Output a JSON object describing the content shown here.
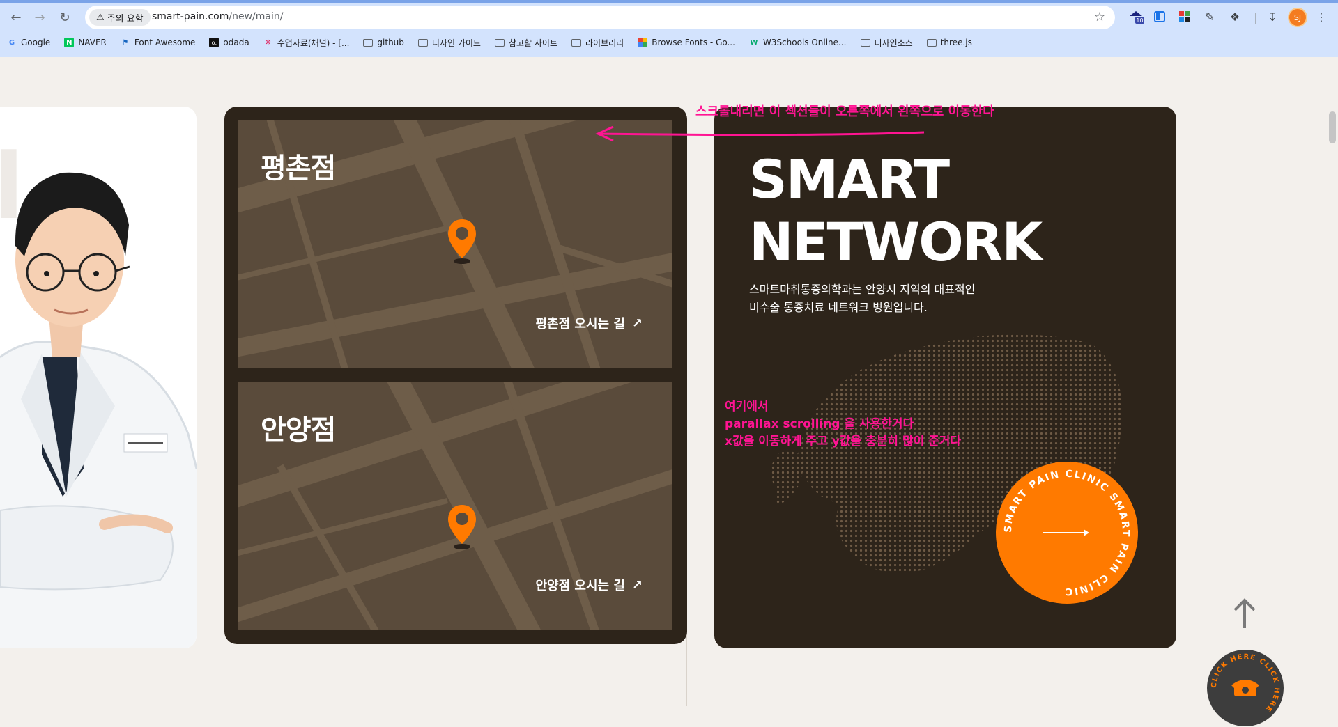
{
  "browser": {
    "security_chip": "주의 요함",
    "url_host": "smart-pain.com",
    "url_path": "/new/main/",
    "profile_initials": "SJ",
    "extension_badge": "10",
    "bookmarks": [
      {
        "label": "Google",
        "icon": "google-icon"
      },
      {
        "label": "NAVER",
        "icon": "naver-icon"
      },
      {
        "label": "Font Awesome",
        "icon": "flag-icon"
      },
      {
        "label": "odada",
        "icon": "odada-icon"
      },
      {
        "label": "수업자료(채널) - [...",
        "icon": "slack-icon"
      },
      {
        "label": "github",
        "icon": "folder-icon"
      },
      {
        "label": "디자인 가이드",
        "icon": "folder-icon"
      },
      {
        "label": "참고할 사이트",
        "icon": "folder-icon"
      },
      {
        "label": "라이브러리",
        "icon": "folder-icon"
      },
      {
        "label": "Browse Fonts - Go...",
        "icon": "google-fonts-icon"
      },
      {
        "label": "W3Schools Online...",
        "icon": "w3schools-icon"
      },
      {
        "label": "디자인소스",
        "icon": "folder-icon"
      },
      {
        "label": "three.js",
        "icon": "folder-icon"
      }
    ]
  },
  "locations": [
    {
      "title": "평촌점",
      "link": "평촌점 오시는 길",
      "arrow": "↗"
    },
    {
      "title": "안양점",
      "link": "안양점 오시는 길",
      "arrow": "↗"
    }
  ],
  "network": {
    "title_line1": "SMART",
    "title_line2": "NETWORK",
    "desc_line1": "스마트마취통증의학과는 안양시 지역의 대표적인",
    "desc_line2": "비수술 통증치료 네트워크 병원입니다.",
    "circle_text": "SMART PAIN CLINIC SMART PAIN CLINIC "
  },
  "annotations": {
    "top": "스크롤내리면 이 섹션들이 오른쪽에서 왼쪽으로 이동한다",
    "mid_line1": "여기에서",
    "mid_line2": "parallax scrolling 을 사용한거다",
    "mid_line3": "x값을 이동하게 주고 y값을 충분히 많이 준거다"
  },
  "call_button": {
    "text": "CLICK HERE CLICK HERE "
  },
  "colors": {
    "accent": "#ff7a00",
    "panel": "#2d241a",
    "map": "#5a4b3b",
    "annotation": "#ff1493",
    "page_bg": "#f3f0ec"
  }
}
